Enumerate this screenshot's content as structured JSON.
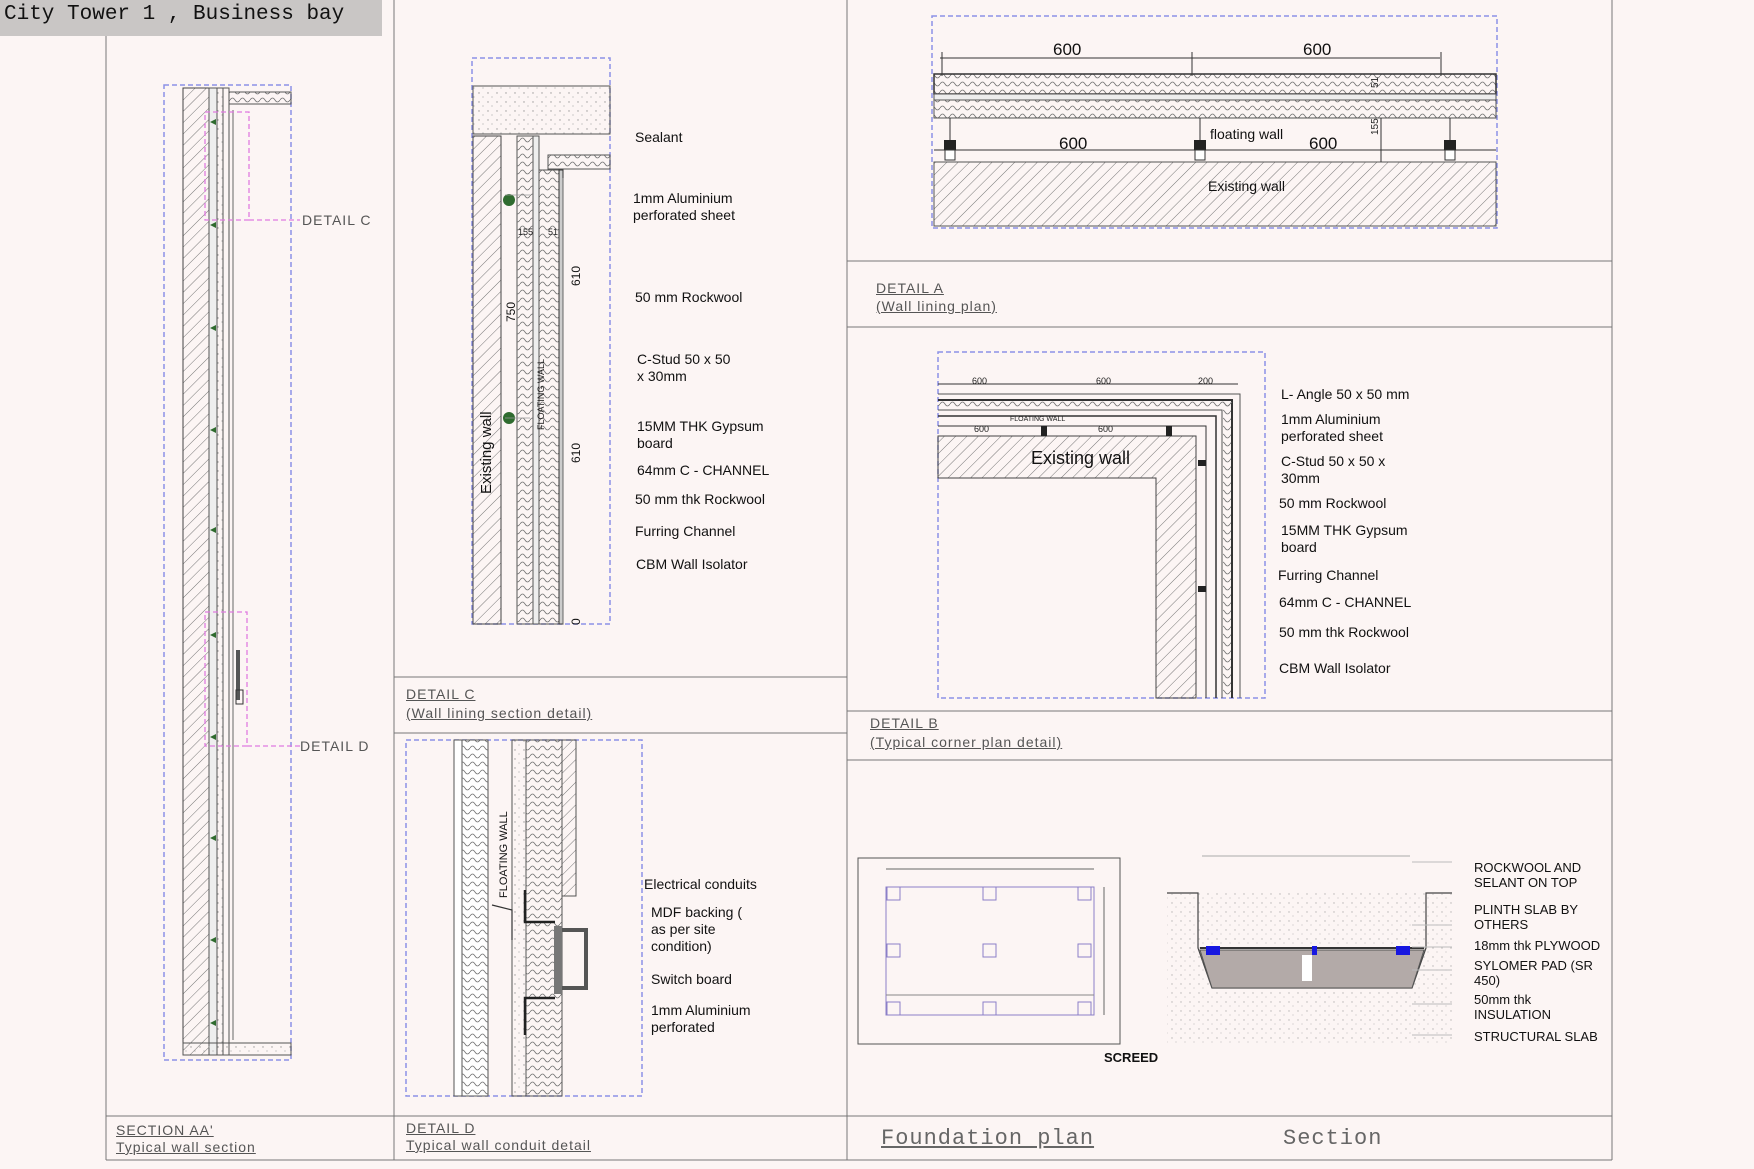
{
  "project_title": "City Tower 1 , Business bay",
  "captions": {
    "section_aa": {
      "title": "SECTION AA'",
      "subtitle": "Typical wall section"
    },
    "detail_c": {
      "title": "DETAIL C",
      "subtitle": "(Wall lining section detail)"
    },
    "detail_d": {
      "title": "DETAIL D",
      "subtitle": "Typical wall conduit detail"
    },
    "detail_a": {
      "title": "DETAIL A",
      "subtitle": "(Wall lining plan)"
    },
    "detail_b": {
      "title": "DETAIL B",
      "subtitle": "(Typical corner plan detail)"
    },
    "foundation_plan": "Foundation plan",
    "section": "Section"
  },
  "section_aa": {
    "callout_c": "DETAIL C",
    "callout_d": "DETAIL D"
  },
  "detail_c": {
    "existing_wall": "Existing wall",
    "floating_wall": "FLOATING WALL",
    "dims": [
      "750",
      "610",
      "610",
      "155",
      "51",
      "0"
    ],
    "labels": [
      "Sealant",
      "1mm Aluminium perforated sheet",
      "50 mm Rockwool",
      "C-Stud 50 x 50 x 30mm",
      "15MM THK Gypsum board",
      "64mm C - CHANNEL",
      "50 mm thk Rockwool",
      "Furring Channel",
      "CBM Wall Isolator"
    ]
  },
  "detail_a": {
    "dims_top": [
      "600",
      "600"
    ],
    "dims_bottom": [
      "600",
      "600"
    ],
    "floating_wall": "floating wall",
    "existing_wall": "Existing wall",
    "small_dims": [
      "51",
      "155"
    ]
  },
  "detail_b": {
    "existing_wall": "Existing wall",
    "floating_wall": "FLOATING WALL",
    "top_dims": [
      "600",
      "600",
      "200"
    ],
    "inner_dims": [
      "600",
      "600"
    ],
    "labels": [
      "L- Angle 50 x 50 mm",
      "1mm Aluminium perforated sheet",
      "C-Stud 50 x 50 x 30mm",
      "50 mm Rockwool",
      "15MM THK Gypsum board",
      "Furring Channel",
      "64mm C - CHANNEL",
      "50 mm thk Rockwool",
      "CBM Wall Isolator"
    ]
  },
  "detail_d": {
    "floating_wall": "FLOATING WALL",
    "labels": [
      "Electrical conduits",
      "MDF backing ( as per site condition)",
      "Switch board",
      "1mm Aluminium perforated"
    ]
  },
  "foundation": {
    "screed": "SCREED",
    "labels": [
      "ROCKWOOL AND SELANT ON TOP",
      "PLINTH SLAB BY OTHERS",
      "18mm thk PLYWOOD",
      "SYLOMER PAD (SR 450)",
      "50mm thk INSULATION",
      "STRUCTURAL SLAB"
    ]
  },
  "colors": {
    "background": "#fcf5f4",
    "dashed_frame": "#8c92e6",
    "callout": "#e07be0",
    "pad": "#1717e0"
  }
}
